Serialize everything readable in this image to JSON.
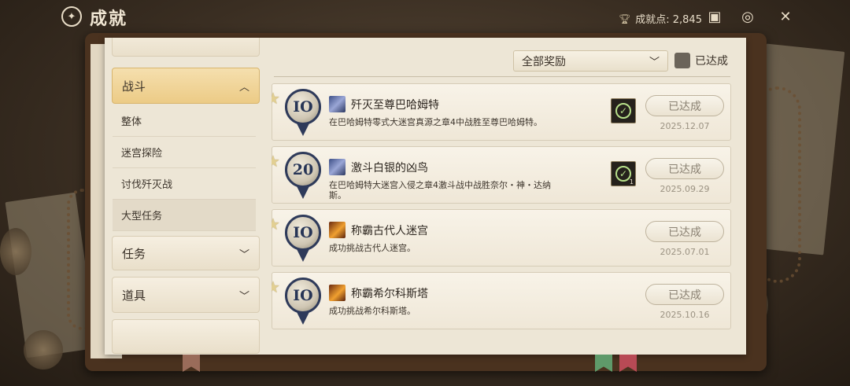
{
  "header": {
    "title": "成就",
    "title_icon": "achievement-emblem-icon",
    "points_label": "成就点: 2,845",
    "buttons": [
      "ranking-icon",
      "badge-icon",
      "close-icon"
    ]
  },
  "sidebar": {
    "top_partial_label": "",
    "categories": [
      {
        "label": "战斗",
        "expanded": true
      },
      {
        "label": "任务",
        "expanded": false
      },
      {
        "label": "道具",
        "expanded": false
      }
    ],
    "subitems": [
      "整体",
      "迷宫探险",
      "讨伐歼灭战",
      "大型任务"
    ],
    "selected_subitem": "大型任务"
  },
  "filter": {
    "dropdown_value": "全部奖励",
    "checkbox_label": "已达成",
    "checked": false
  },
  "achievements": [
    {
      "medal": "IO",
      "icon": "blue",
      "title": "歼灭至尊巴哈姆特",
      "desc": "在巴哈姆特零式大迷宫真源之章4中战胜至尊巴哈姆特。",
      "has_reward": true,
      "reward_count": "",
      "status": "已达成",
      "date": "2025.12.07"
    },
    {
      "medal": "20",
      "icon": "blue",
      "title": "激斗白银的凶鸟",
      "desc": "在巴哈姆特大迷宫入侵之章4激斗战中战胜奈尔・神・达纳斯。",
      "has_reward": true,
      "reward_count": "1",
      "status": "已达成",
      "date": "2025.09.29"
    },
    {
      "medal": "IO",
      "icon": "fire",
      "title": "称霸古代人迷宫",
      "desc": "成功挑战古代人迷宫。",
      "has_reward": false,
      "reward_count": "",
      "status": "已达成",
      "date": "2025.07.01"
    },
    {
      "medal": "IO",
      "icon": "fire",
      "title": "称霸希尔科斯塔",
      "desc": "成功挑战希尔科斯塔。",
      "has_reward": false,
      "reward_count": "",
      "status": "已达成",
      "date": "2025.10.16"
    }
  ],
  "colors": {
    "active_category": "#eccb86",
    "medal_ring": "#2e3a5a",
    "reward_check": "#b7e08a"
  }
}
